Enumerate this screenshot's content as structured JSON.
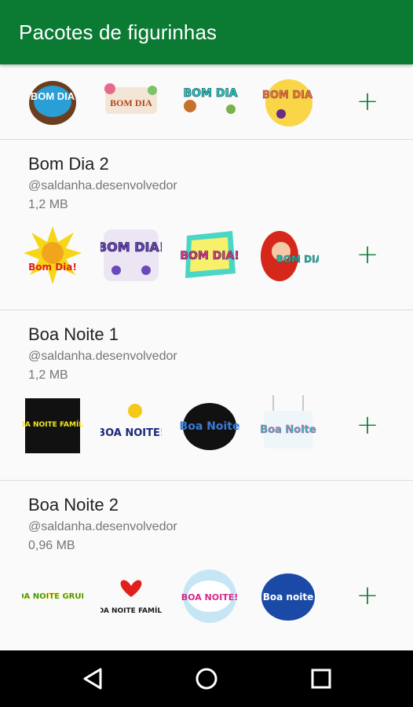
{
  "appbar": {
    "title": "Pacotes de figurinhas",
    "color": "#0b7a33"
  },
  "packs": [
    {
      "name": "",
      "author": "",
      "size": "",
      "add_icon": "plus-icon",
      "stickers": [
        "BOM DIA",
        "BOM DIA",
        "BOM DIA",
        "BOM DIA"
      ]
    },
    {
      "name": "Bom Dia 2",
      "author": "@saldanha.desenvolvedor",
      "size": "1,2 MB",
      "add_icon": "plus-icon",
      "stickers": [
        "Bom Dia!",
        "BOM DIA!",
        "BOM DIA!",
        "BOM DIA!"
      ]
    },
    {
      "name": "Boa Noite 1",
      "author": "@saldanha.desenvolvedor",
      "size": "1,2 MB",
      "add_icon": "plus-icon",
      "stickers": [
        "BOA NOITE FAMÍLIA",
        "BOA NOITE!",
        "Boa Noite",
        "Boa Noite"
      ]
    },
    {
      "name": "Boa Noite 2",
      "author": "@saldanha.desenvolvedor",
      "size": "0,96 MB",
      "add_icon": "plus-icon",
      "stickers": [
        "BOA NOITE GRUPO",
        "BOA NOITE FAMÍLIA",
        "BOA NOITE!",
        "Boa noite"
      ]
    }
  ],
  "navbar": {
    "icons": [
      "back-icon",
      "home-icon",
      "recents-icon"
    ]
  }
}
